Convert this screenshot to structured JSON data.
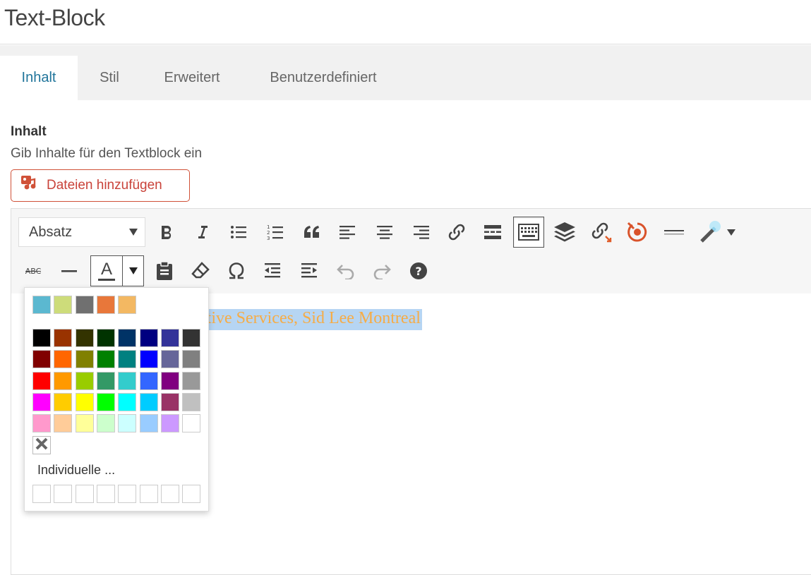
{
  "window": {
    "title": "Text-Block"
  },
  "tabs": [
    {
      "label": "Inhalt",
      "active": true
    },
    {
      "label": "Stil",
      "active": false
    },
    {
      "label": "Erweitert",
      "active": false
    },
    {
      "label": "Benutzerdefiniert",
      "active": false
    }
  ],
  "section": {
    "title": "Inhalt",
    "description": "Gib Inhalte für den Textblock ein"
  },
  "add_files": {
    "label": "Dateien hinzufügen",
    "color": "#d05138"
  },
  "toolbar": {
    "format_select": "Absatz",
    "row1_icons": [
      "bold-icon",
      "italic-icon",
      "bullet-list-icon",
      "numbered-list-icon",
      "blockquote-icon",
      "align-left-icon",
      "align-center-icon",
      "align-right-icon",
      "link-icon",
      "read-more-icon",
      "toolbar-toggle-icon",
      "layers-icon",
      "unlink-icon",
      "target-icon",
      "horizontal-rule-icon",
      "magic-wand-icon"
    ],
    "row2_icons": [
      "strikethrough-icon",
      "horizontal-line-icon",
      "text-color-icon",
      "paste-text-icon",
      "clear-formatting-icon",
      "special-character-icon",
      "outdent-icon",
      "indent-icon",
      "undo-icon",
      "redo-icon",
      "help-icon"
    ],
    "strikethrough_label": "ABC",
    "text_color_letter": "A"
  },
  "editor": {
    "visible_text": "ative Services, Sid Lee Montreal",
    "text_color": "#f6ac46",
    "selection_color": "#b6d5f3"
  },
  "color_picker": {
    "recent": [
      "#5bb8d0",
      "#cddc7a",
      "#707070",
      "#e8773a",
      "#f3b862"
    ],
    "grid": [
      [
        "#000000",
        "#993300",
        "#333300",
        "#003300",
        "#003366",
        "#000080",
        "#333399",
        "#333333"
      ],
      [
        "#800000",
        "#ff6600",
        "#808000",
        "#008000",
        "#008080",
        "#0000ff",
        "#666699",
        "#808080"
      ],
      [
        "#ff0000",
        "#ff9900",
        "#99cc00",
        "#339966",
        "#33cccc",
        "#3366ff",
        "#800080",
        "#999999"
      ],
      [
        "#ff00ff",
        "#ffcc00",
        "#ffff00",
        "#00ff00",
        "#00ffff",
        "#00ccff",
        "#993366",
        "#c0c0c0"
      ],
      [
        "#ff99cc",
        "#ffcc99",
        "#ffff99",
        "#ccffcc",
        "#ccffff",
        "#99ccff",
        "#cc99ff",
        "#ffffff"
      ]
    ],
    "custom_label": "Individuelle ...",
    "custom_slots": 8
  }
}
